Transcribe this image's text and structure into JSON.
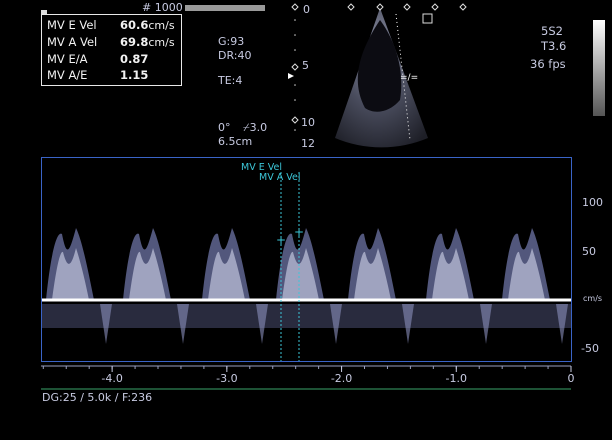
{
  "top": {
    "frame_count": "# 1000"
  },
  "measurements": [
    {
      "label": "MV E Vel",
      "value": "60.6",
      "unit": "cm/s"
    },
    {
      "label": "MV A Vel",
      "value": "69.8",
      "unit": "cm/s"
    },
    {
      "label": "MV E/A",
      "value": "0.87",
      "unit": ""
    },
    {
      "label": "MV A/E",
      "value": "1.15",
      "unit": ""
    }
  ],
  "params": {
    "gain": "G:93",
    "dynamic_range": "DR:40",
    "te": "TE:4",
    "angle": "0°",
    "angle_corr": "3.0",
    "depth": "6.5cm"
  },
  "probe": {
    "model": "5S2",
    "preset": "T3.6",
    "fps": "36 fps"
  },
  "depth_scale": [
    "0",
    "5",
    "10",
    "12"
  ],
  "cursor_labels": {
    "e": "MV E Vel",
    "a": "MV A Vel"
  },
  "doppler": {
    "y_ticks": [
      {
        "v": 100,
        "label": "100"
      },
      {
        "v": 50,
        "label": "50"
      },
      {
        "v": -50,
        "label": "-50"
      }
    ],
    "y_unit": "cm/s",
    "x_ticks": [
      {
        "v": -4.0,
        "label": "-4.0"
      },
      {
        "v": -3.0,
        "label": "-3.0"
      },
      {
        "v": -2.0,
        "label": "-2.0"
      },
      {
        "v": -1.0,
        "label": "-1.0"
      },
      {
        "v": 0,
        "label": "0"
      }
    ]
  },
  "status": "DG:25  / 5.0k   / F:236",
  "colors": {
    "frame": "#3a64c8",
    "cursor": "#3cc6d8",
    "baseline": "#ffffff",
    "axis_green": "#3aa36a"
  }
}
